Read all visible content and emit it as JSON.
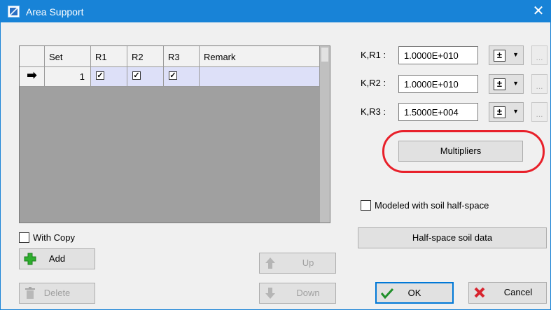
{
  "window": {
    "title": "Area Support"
  },
  "grid": {
    "columns": [
      "Set",
      "R1",
      "R2",
      "R3",
      "Remark"
    ],
    "rows": [
      {
        "marker": "➡",
        "set": "1",
        "r1": true,
        "r2": true,
        "r3": true,
        "remark": ""
      }
    ]
  },
  "k_fields": [
    {
      "label": "K,R1 :",
      "value": "1.0000E+010"
    },
    {
      "label": "K,R2 :",
      "value": "1.0000E+010"
    },
    {
      "label": "K,R3 :",
      "value": "1.5000E+004"
    }
  ],
  "buttons": {
    "multipliers": "Multipliers",
    "half_space": "Half-space soil data",
    "add": "Add",
    "delete": "Delete",
    "up": "Up",
    "down": "Down",
    "ok": "OK",
    "cancel": "Cancel",
    "ellipsis": "..."
  },
  "checkboxes": {
    "with_copy": {
      "label": "With Copy",
      "checked": false
    },
    "soil_half_space": {
      "label": "Modeled with soil half-space",
      "checked": false
    }
  },
  "colors": {
    "titlebar": "#1883d7",
    "highlight": "#e8202a",
    "row_selected": "#dde0f8"
  }
}
